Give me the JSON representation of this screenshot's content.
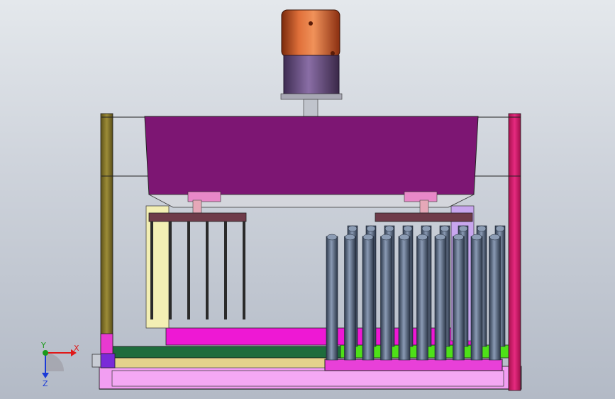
{
  "viewport": {
    "background_top": "#e4e8ec",
    "background_bottom": "#b3bac6"
  },
  "colors": {
    "motor_cap": "#c8501e",
    "motor_body": "#6a4f82",
    "main_housing": "#7d1673",
    "left_column": "#8a7a2a",
    "right_column": "#d81a6e",
    "yellow_plate": "#f3efb4",
    "violet_plate": "#c8a6ee",
    "magenta_bar": "#ee18d4",
    "green_bar": "#1e6c3c",
    "lime_bar": "#4ee018",
    "tan_bar": "#e4d28c",
    "pink_frame": "#f29ef2",
    "roller": "#5a6b84",
    "rod": "#2a2a2a",
    "bracket_plate": "#6e3b49"
  },
  "axis_triad": {
    "x_label": "X",
    "y_label": "Y",
    "z_label": "Z",
    "x_color": "#e01818",
    "y_color": "#1a9a1a",
    "z_color": "#1a3ad8"
  },
  "assembly": {
    "left_rod_count": 6,
    "back_roller_count": 9,
    "front_roller_count": 10
  }
}
